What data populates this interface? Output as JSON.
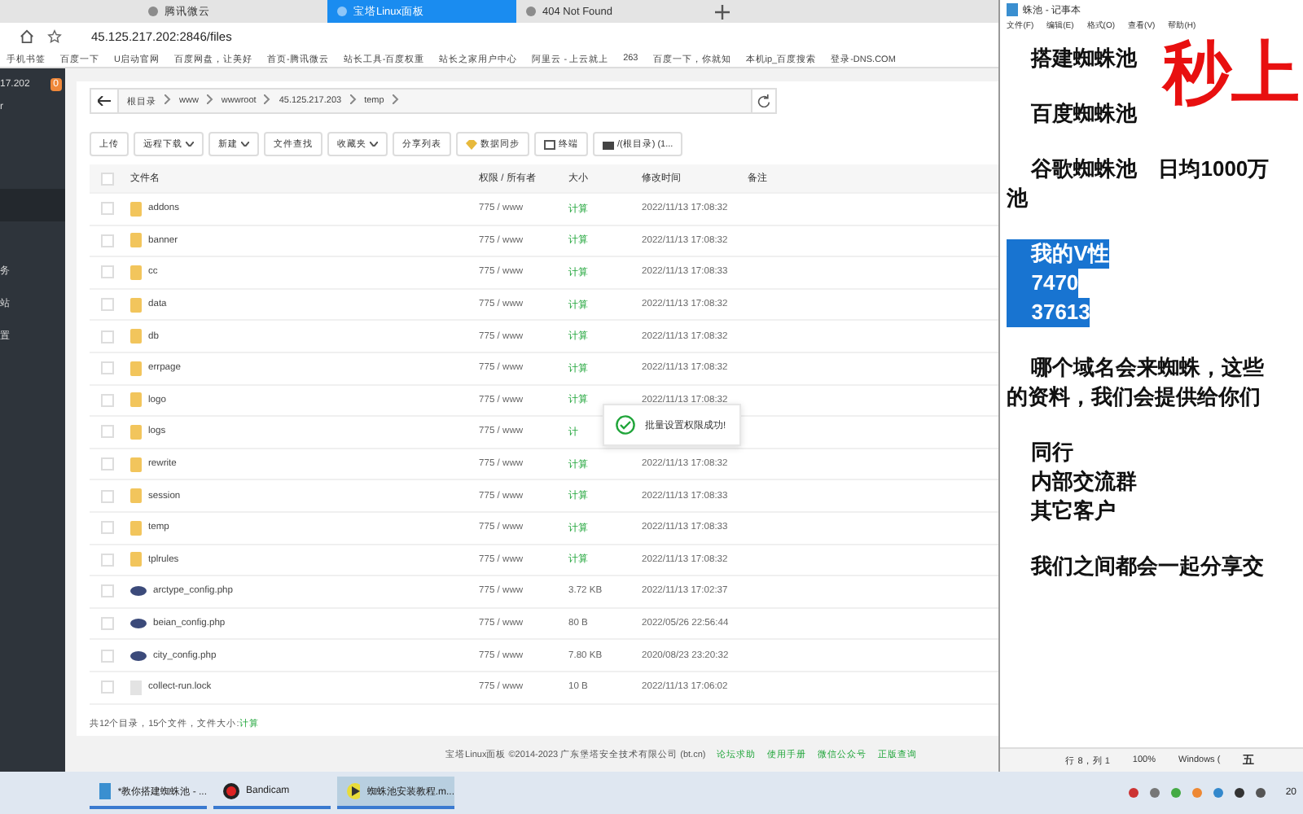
{
  "browser": {
    "tabs": [
      {
        "label": "腾讯微云",
        "selected": false
      },
      {
        "label": "宝塔Linux面板",
        "selected": true
      },
      {
        "label": "404 Not Found",
        "selected": false
      }
    ],
    "address": "45.125.217.202:2846/files",
    "bookmarks": [
      "手机书签",
      "百度一下",
      "U启动官网",
      "百度网盘，让美好",
      "首页-腾讯微云",
      "站长工具-百度权重",
      "站长之家用户中心",
      "阿里云 - 上云就上",
      "263",
      "百度一下，你就知",
      "本机ip_百度搜索",
      "登录-DNS.COM"
    ]
  },
  "sidebar": {
    "server": "17.202",
    "badge": "0",
    "items": [
      {
        "label": "r",
        "selected": false
      },
      {
        "selected": true
      },
      {
        "label": "务",
        "selected": false
      },
      {
        "label": "站",
        "selected": false
      },
      {
        "label": "置",
        "selected": false
      }
    ]
  },
  "breadcrumb": [
    "根目录",
    "www",
    "wwwroot",
    "45.125.217.203",
    "temp"
  ],
  "toolbar": [
    {
      "label": "上传",
      "kind": "plain"
    },
    {
      "label": "远程下载",
      "kind": "dropdown"
    },
    {
      "label": "新建",
      "kind": "dropdown"
    },
    {
      "label": "文件查找",
      "kind": "plain"
    },
    {
      "label": "收藏夹",
      "kind": "dropdown"
    },
    {
      "label": "分享列表",
      "kind": "plain"
    },
    {
      "label": "数据同步",
      "kind": "sync"
    },
    {
      "label": "终端",
      "kind": "terminal"
    },
    {
      "label": "/(根目录) (1...",
      "kind": "disk"
    }
  ],
  "table": {
    "all_checked": false,
    "columns": [
      "文件名",
      "权限 / 所有者",
      "大小",
      "修改时间",
      "备注"
    ],
    "rows": [
      {
        "name": "addons",
        "checked": false,
        "kind": "folder",
        "perm": "775 / www",
        "size": "计算",
        "time": "2022/11/13 17:08:32"
      },
      {
        "name": "banner",
        "checked": false,
        "kind": "folder",
        "perm": "775 / www",
        "size": "计算",
        "time": "2022/11/13 17:08:32"
      },
      {
        "name": "cc",
        "checked": false,
        "kind": "folder",
        "perm": "775 / www",
        "size": "计算",
        "time": "2022/11/13 17:08:33"
      },
      {
        "name": "data",
        "checked": false,
        "kind": "folder",
        "perm": "775 / www",
        "size": "计算",
        "time": "2022/11/13 17:08:32"
      },
      {
        "name": "db",
        "checked": false,
        "kind": "folder",
        "perm": "775 / www",
        "size": "计算",
        "time": "2022/11/13 17:08:32"
      },
      {
        "name": "errpage",
        "checked": false,
        "kind": "folder",
        "perm": "775 / www",
        "size": "计算",
        "time": "2022/11/13 17:08:32"
      },
      {
        "name": "logo",
        "checked": false,
        "kind": "folder",
        "perm": "775 / www",
        "size": "计算",
        "time": "2022/11/13 17:08:32"
      },
      {
        "name": "logs",
        "checked": false,
        "kind": "folder",
        "perm": "775 / www",
        "size": "计"
      },
      {
        "name": "rewrite",
        "checked": false,
        "kind": "folder",
        "perm": "775 / www",
        "size": "计算",
        "time": "2022/11/13 17:08:32"
      },
      {
        "name": "session",
        "checked": false,
        "kind": "folder",
        "perm": "775 / www",
        "size": "计算",
        "time": "2022/11/13 17:08:33"
      },
      {
        "name": "temp",
        "checked": false,
        "kind": "folder",
        "perm": "775 / www",
        "size": "计算",
        "time": "2022/11/13 17:08:33"
      },
      {
        "name": "tplrules",
        "checked": false,
        "kind": "folder",
        "perm": "775 / www",
        "size": "计算",
        "time": "2022/11/13 17:08:32"
      },
      {
        "name": "arctype_config.php",
        "checked": false,
        "kind": "php",
        "perm": "775 / www",
        "size": "3.72 KB",
        "time": "2022/11/13 17:02:37"
      },
      {
        "name": "beian_config.php",
        "checked": false,
        "kind": "php",
        "perm": "775 / www",
        "size": "80 B",
        "time": "2022/05/26 22:56:44"
      },
      {
        "name": "city_config.php",
        "checked": false,
        "kind": "php",
        "perm": "775 / www",
        "size": "7.80 KB",
        "time": "2020/08/23 23:20:32"
      },
      {
        "name": "collect-run.lock",
        "checked": false,
        "kind": "file",
        "perm": "775 / www",
        "size": "10 B",
        "time": "2022/11/13 17:06:02"
      }
    ]
  },
  "toast": "批量设置权限成功!",
  "summary": {
    "text": "共12个目录，15个文件，文件大小:",
    "link": "计算"
  },
  "footer": {
    "copyright": "宝塔Linux面板 ©2014-2023 广东堡塔安全技术有限公司 (bt.cn)",
    "links": [
      "论坛求助",
      "使用手册",
      "微信公众号",
      "正版查询"
    ]
  },
  "notepad": {
    "title": "蛛池 - 记事本",
    "menu": [
      "文件(F)",
      "编辑(E)",
      "格式(O)",
      "查看(V)",
      "帮助(H)"
    ],
    "paragraphs": [
      [
        {
          "text": "搭建蜘蛛池",
          "selected": false
        }
      ],
      [
        {
          "text": "百度蜘蛛池",
          "selected": false
        }
      ],
      [
        {
          "text": "谷歌蜘蛛池　日均1000万",
          "selected": false
        },
        {
          "text": "池",
          "selected": false,
          "flush": true
        }
      ],
      [
        {
          "text": "我的V性",
          "selected": true
        },
        {
          "text": "7470",
          "selected": true
        },
        {
          "text": "37613",
          "selected": true
        }
      ],
      [
        {
          "text": "哪个域名会来蜘蛛，这些",
          "selected": false
        },
        {
          "text": "的资料，我们会提供给你们",
          "selected": false,
          "flush": true
        }
      ],
      [
        {
          "text": "同行",
          "selected": false
        },
        {
          "text": "内部交流群",
          "selected": false
        },
        {
          "text": "其它客户",
          "selected": false
        }
      ],
      [
        {
          "text": "我们之间都会一起分享交",
          "selected": false
        }
      ]
    ],
    "status": [
      "行 8，列 1",
      "100%",
      "Windows ("
    ],
    "ime": "五"
  },
  "overlay_caption": "秒上",
  "taskbar": [
    {
      "label": "*教你搭建蜘蛛池 - ...",
      "kind": "notepad",
      "selected": false
    },
    {
      "label": "Bandicam",
      "kind": "record",
      "selected": false
    },
    {
      "label": "蜘蛛池安装教程.m...",
      "kind": "player",
      "selected": true
    }
  ],
  "clock": "20"
}
